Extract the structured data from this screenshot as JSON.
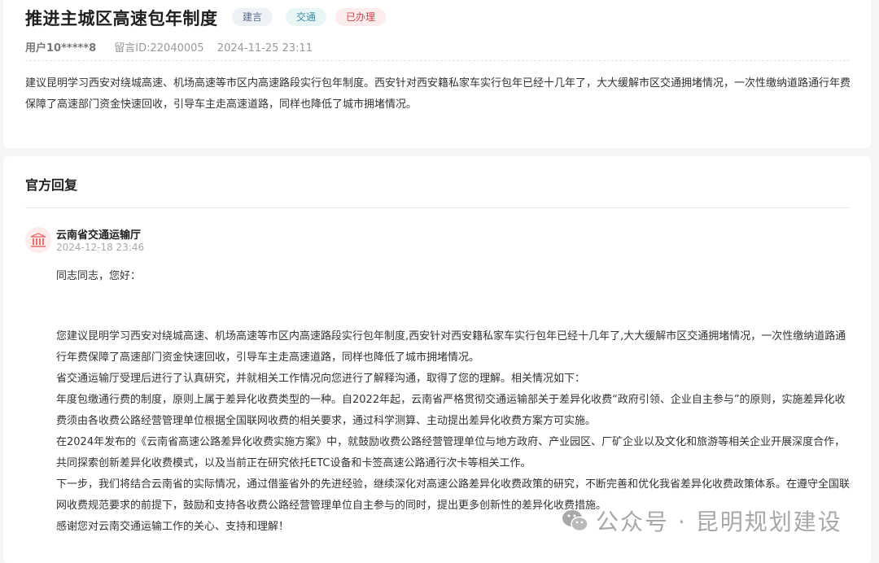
{
  "suggestion": {
    "title": "推进主城区高速包年制度",
    "tags": [
      {
        "label": "建言",
        "bg": "#eef1f6",
        "color": "#5a6b8a"
      },
      {
        "label": "交通",
        "bg": "#e8f6f6",
        "color": "#3a8fa0"
      },
      {
        "label": "已办理",
        "bg": "#fdecee",
        "color": "#d9434f"
      }
    ],
    "user": "用户10*****8",
    "message_id": "留言ID:22040005",
    "time": "2024-11-25 23:11",
    "content": "建议昆明学习西安对绕城高速、机场高速等市区内高速路段实行包年制度。西安针对西安籍私家车实行包年已经十几年了，大大缓解市区交通拥堵情况，一次性缴纳道路通行年费保障了高速部门资金快速回收，引导车主走高速道路，同样也降低了城市拥堵情况。"
  },
  "reply": {
    "heading": "官方回复",
    "org": "云南省交通运输厅",
    "org_icon": "government-building-icon",
    "time": "2024-12-18 23:46",
    "greeting": "同志同志，您好：",
    "paragraphs": [
      "您建议昆明学习西安对绕城高速、机场高速等市区内高速路段实行包年制度,西安针对西安籍私家车实行包年已经十几年了,大大缓解市区交通拥堵情况，一次性缴纳道路通行年费保障了高速部门资金快速回收，引导车主走高速道路，同样也降低了城市拥堵情况。",
      "省交通运输厅受理后进行了认真研究，并就相关工作情况向您进行了解释沟通，取得了您的理解。相关情况如下：",
      "年度包缴通行费的制度，原则上属于差异化收费类型的一种。自2022年起，云南省严格贯彻交通运输部关于差异化收费“政府引领、企业自主参与”的原则，实施差异化收费须由各收费公路经营管理单位根据全国联网收费的相关要求，通过科学测算、主动提出差异化收费方案方可实施。",
      "在2024年发布的《云南省高速公路差异化收费实施方案》中，就鼓励收费公路经营管理单位与地方政府、产业园区、厂矿企业以及文化和旅游等相关企业开展深度合作，共同探索创新差异化收费模式，以及当前正在研究依托ETC设备和卡签高速公路通行次卡等相关工作。",
      "下一步，我们将结合云南省的实际情况，通过借鉴省外的先进经验，继续深化对高速公路差异化收费政策的研究，不断完善和优化我省差异化收费政策体系。在遵守全国联网收费规范要求的前提下，鼓励和支持各收费公路经营管理单位自主参与的同时，提出更多创新性的差异化收费措施。",
      "感谢您对云南交通运输工作的关心、支持和理解！"
    ]
  },
  "watermark": {
    "text": "公众号 · 昆明规划建设",
    "icon": "wechat-icon"
  }
}
